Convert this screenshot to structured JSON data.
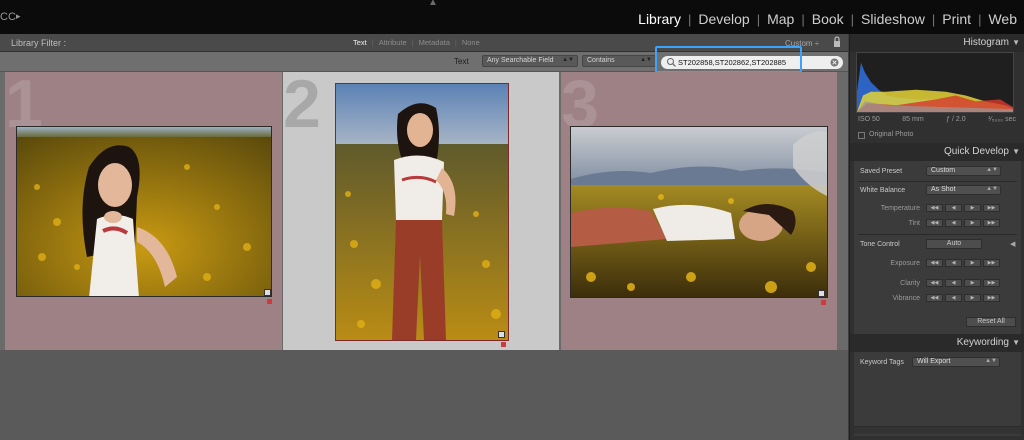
{
  "app": {
    "brand": "CC",
    "brand_arrow": "▸",
    "top_caret": "▲"
  },
  "modules": [
    {
      "label": "Library",
      "active": true
    },
    {
      "label": "Develop"
    },
    {
      "label": "Map"
    },
    {
      "label": "Book"
    },
    {
      "label": "Slideshow"
    },
    {
      "label": "Print"
    },
    {
      "label": "Web"
    }
  ],
  "module_separator": "|",
  "library_filter": {
    "label": "Library Filter :",
    "tabs": [
      "Text",
      "Attribute",
      "Metadata",
      "None"
    ],
    "active_tab": "Text",
    "preset": "Custom",
    "preset_arrow": "÷"
  },
  "text_filter": {
    "label": "Text",
    "field_value": "Any Searchable Field",
    "rule_value": "Contains",
    "dropdown_arrow": "▲▼",
    "search_value": "ST202858,ST202862,ST202885"
  },
  "grid": {
    "cells": [
      {
        "number": "1",
        "selected": false
      },
      {
        "number": "2",
        "selected": true
      },
      {
        "number": "3",
        "selected": false
      }
    ]
  },
  "histogram": {
    "title": "Histogram",
    "iso": "ISO 50",
    "focal": "85 mm",
    "aperture": "ƒ / 2.0",
    "shutter": "¹⁄₅₀₀₀ sec",
    "original_photo": "Original Photo"
  },
  "quick_develop": {
    "title": "Quick Develop",
    "saved_preset_label": "Saved Preset",
    "saved_preset_value": "Custom",
    "white_balance_label": "White Balance",
    "white_balance_value": "As Shot",
    "temperature_label": "Temperature",
    "tint_label": "Tint",
    "tone_control_label": "Tone Control",
    "auto_label": "Auto",
    "exposure_label": "Exposure",
    "clarity_label": "Clarity",
    "vibrance_label": "Vibrance",
    "reset_label": "Reset All",
    "step_buttons": [
      "◀◀",
      "◀",
      "▶",
      "▶▶"
    ]
  },
  "keywording": {
    "title": "Keywording",
    "tags_label": "Keyword Tags",
    "tags_value": "Will Export"
  },
  "panel_triangle": "▼",
  "panel_triangle_left": "◀",
  "colors": {
    "accent": "#3aa3ff",
    "cell_bg": "#9e8185",
    "selected_cell_bg": "#c9c9c9",
    "flag": "#d23a3a"
  }
}
